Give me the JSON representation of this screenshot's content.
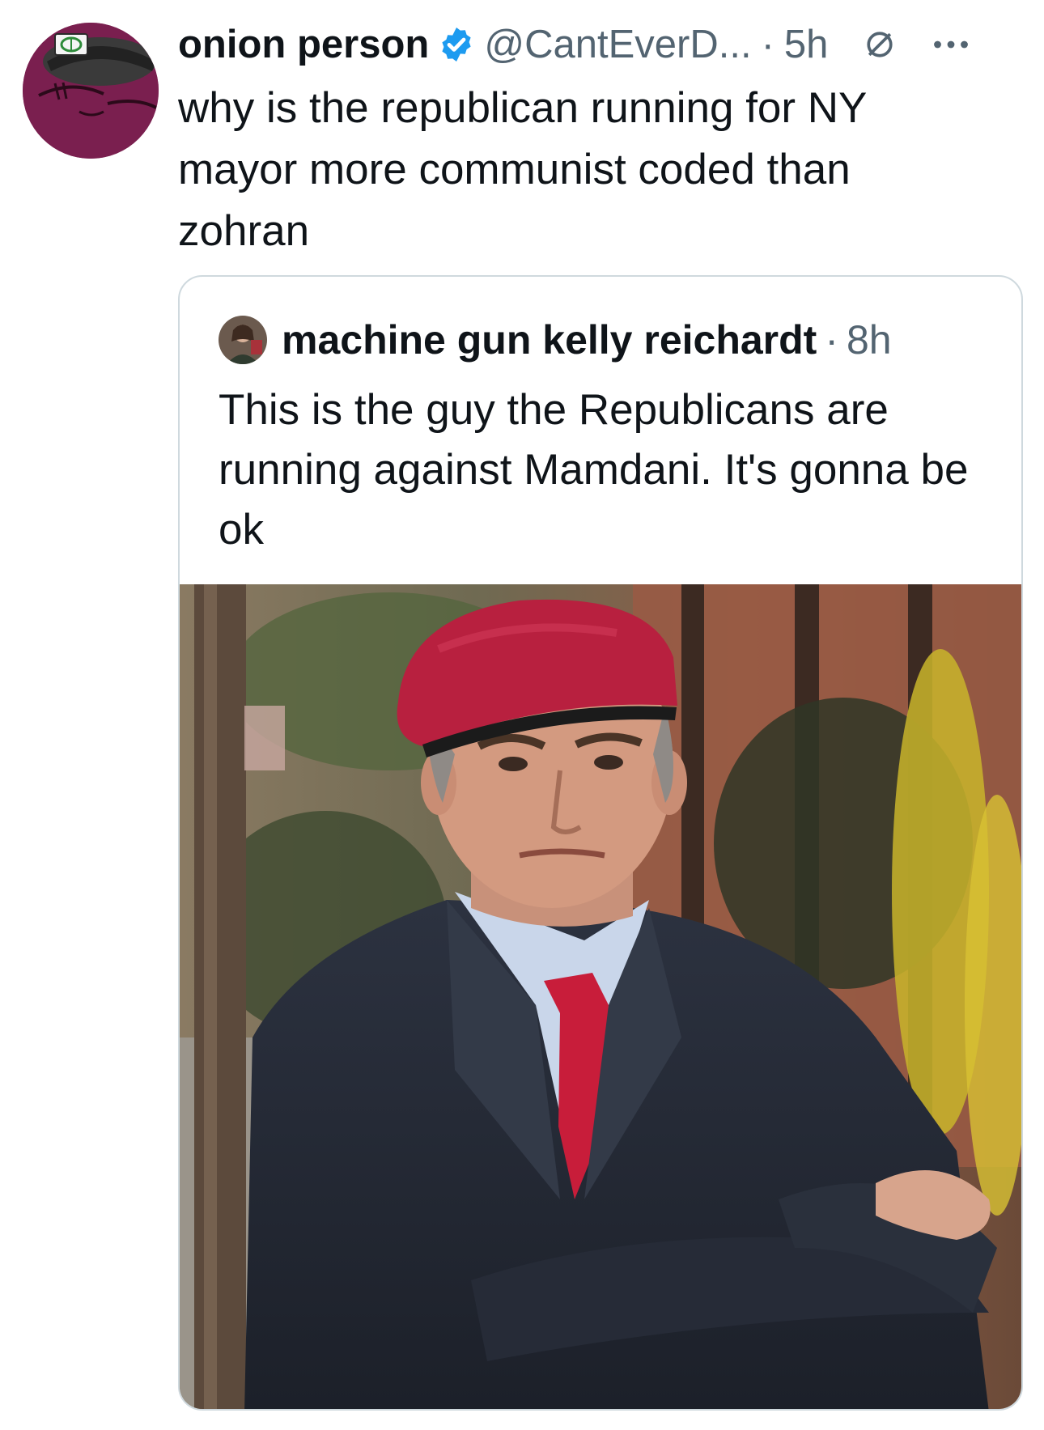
{
  "tweet": {
    "display_name": "onion person",
    "handle": "@CantEverD...",
    "separator": "·",
    "time": "5h",
    "verified_icon": "verified-badge-icon",
    "misc_icon": "circle-slash-icon",
    "more_icon": "more-horizontal-icon",
    "text": "why is the republican running for NY mayor more communist coded than zohran",
    "avatar_icon": "onion-character-avatar"
  },
  "quoted_tweet": {
    "display_name": "machine gun kelly reichardt",
    "separator": "·",
    "time": "8h",
    "text": "This is the guy the Republicans are running against Mamdani. It's gonna be ok",
    "photo": "man in red beret and dark suit, arms crossed, tree-lined brownstone street behind"
  },
  "colors": {
    "text_primary": "#0f1419",
    "text_secondary": "#536471",
    "verified_blue": "#1d9bf0",
    "card_border": "#cfd9de",
    "avatar_bg": "#7a1f4f"
  }
}
